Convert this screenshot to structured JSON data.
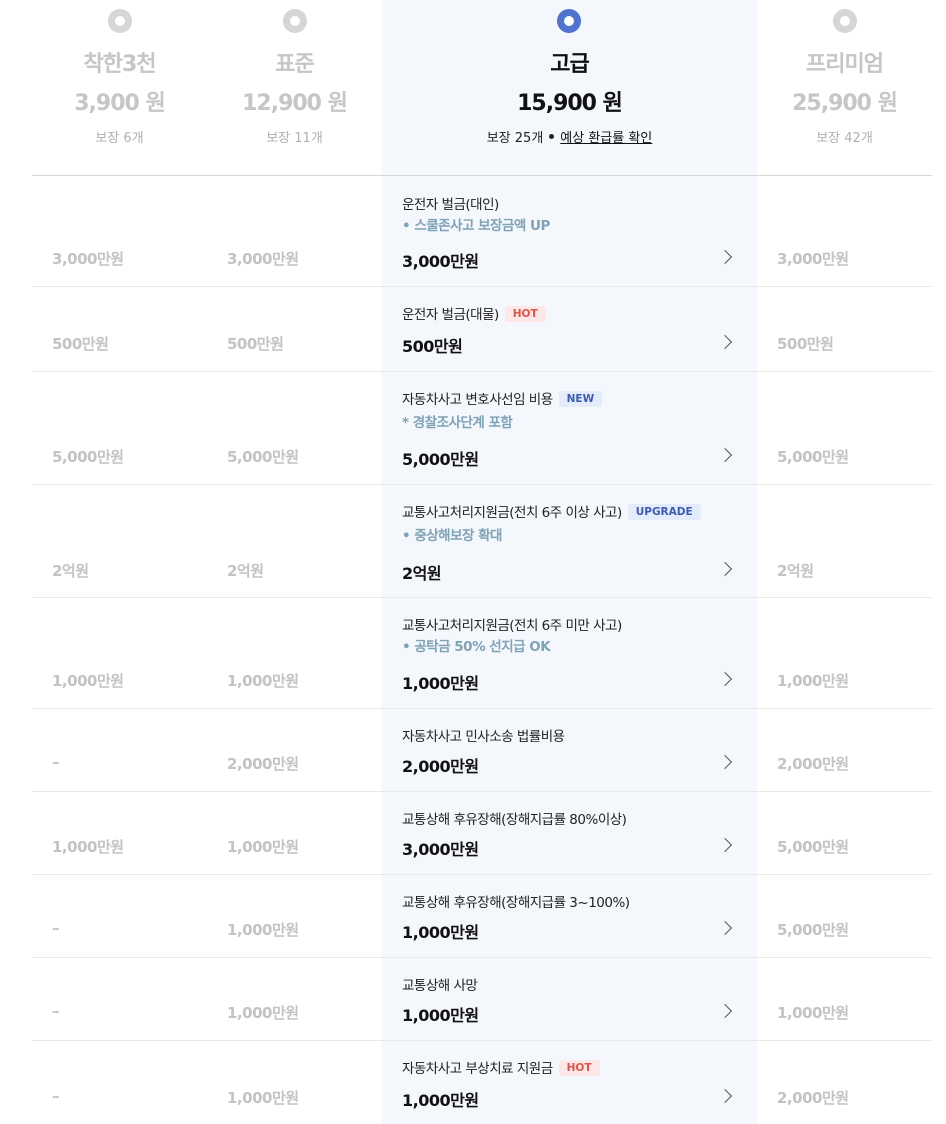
{
  "plans": [
    {
      "name": "착한3천",
      "price": "3,900 원",
      "coverage": "보장 6개",
      "selected": false
    },
    {
      "name": "표준",
      "price": "12,900 원",
      "coverage": "보장 11개",
      "selected": false
    },
    {
      "name": "고급",
      "price": "15,900 원",
      "coverage": "보장 25개",
      "refund_link": "예상 환급률 확인",
      "selected": true
    },
    {
      "name": "프리미엄",
      "price": "25,900 원",
      "coverage": "보장 42개",
      "selected": false
    }
  ],
  "rows": [
    {
      "title": "운전자 벌금(대인)",
      "sub": "• 스쿨존사고 보장금액 UP",
      "values": [
        "3,000만원",
        "3,000만원",
        "3,000만원",
        "3,000만원"
      ]
    },
    {
      "title": "운전자 벌금(대물)",
      "badge": "HOT",
      "values": [
        "500만원",
        "500만원",
        "500만원",
        "500만원"
      ]
    },
    {
      "title": "자동차사고 변호사선임 비용",
      "badge": "NEW",
      "sub": "* 경찰조사단계 포함",
      "values": [
        "5,000만원",
        "5,000만원",
        "5,000만원",
        "5,000만원"
      ]
    },
    {
      "title": "교통사고처리지원금(전치 6주 이상 사고)",
      "badge": "UPGRADE",
      "sub": "• 중상해보장 확대",
      "values": [
        "2억원",
        "2억원",
        "2억원",
        "2억원"
      ]
    },
    {
      "title": "교통사고처리지원금(전치 6주 미만 사고)",
      "sub": "• 공탁금 50% 선지급 OK",
      "values": [
        "1,000만원",
        "1,000만원",
        "1,000만원",
        "1,000만원"
      ]
    },
    {
      "title": "자동차사고 민사소송 법률비용",
      "values": [
        "–",
        "2,000만원",
        "2,000만원",
        "2,000만원"
      ]
    },
    {
      "title": "교통상해 후유장해(장해지급률 80%이상)",
      "values": [
        "1,000만원",
        "1,000만원",
        "3,000만원",
        "5,000만원"
      ]
    },
    {
      "title": "교통상해 후유장해(장해지급률 3~100%)",
      "values": [
        "–",
        "1,000만원",
        "1,000만원",
        "5,000만원"
      ]
    },
    {
      "title": "교통상해 사망",
      "values": [
        "–",
        "1,000만원",
        "1,000만원",
        "1,000만원"
      ]
    },
    {
      "title": "자동차사고 부상치료 지원금",
      "badge": "HOT",
      "values": [
        "–",
        "1,000만원",
        "1,000만원",
        "2,000만원"
      ]
    }
  ]
}
